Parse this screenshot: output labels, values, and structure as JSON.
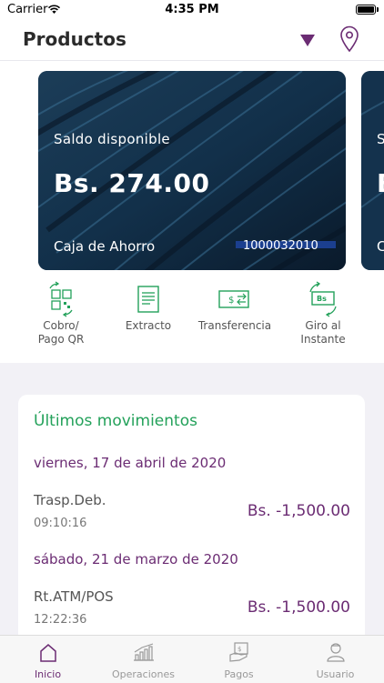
{
  "status_bar": {
    "carrier": "Carrier",
    "time": "4:35 PM"
  },
  "header": {
    "title": "Productos",
    "accent_color": "#6b2c73"
  },
  "cards": [
    {
      "label": "Saldo disponible",
      "amount": "Bs. 274.00",
      "type": "Caja de Ahorro",
      "account_number": "1000032010"
    },
    {
      "label": "S",
      "amount": "B",
      "type": "C"
    }
  ],
  "actions": [
    {
      "label": "Cobro/\nPago QR",
      "icon": "qr-icon"
    },
    {
      "label": "Extracto",
      "icon": "document-icon"
    },
    {
      "label": "Transferencia",
      "icon": "transfer-icon"
    },
    {
      "label": "Giro al\nInstante",
      "icon": "instant-transfer-icon"
    }
  ],
  "movements": {
    "title": "Últimos movimientos",
    "title_color": "#23a15a",
    "groups": [
      {
        "date": "viernes, 17 de abril de 2020",
        "items": [
          {
            "description": "Trasp.Deb.",
            "time": "09:10:16",
            "amount": "Bs. -1,500.00"
          }
        ]
      },
      {
        "date": "sábado, 21 de marzo de 2020",
        "items": [
          {
            "description": "Rt.ATM/POS",
            "time": "12:22:36",
            "amount": "Bs. -1,500.00"
          }
        ]
      }
    ]
  },
  "tabbar": [
    {
      "label": "Inicio",
      "icon": "home-icon",
      "active": true
    },
    {
      "label": "Operaciones",
      "icon": "chart-icon",
      "active": false
    },
    {
      "label": "Pagos",
      "icon": "payment-icon",
      "active": false
    },
    {
      "label": "Usuario",
      "icon": "user-icon",
      "active": false
    }
  ]
}
